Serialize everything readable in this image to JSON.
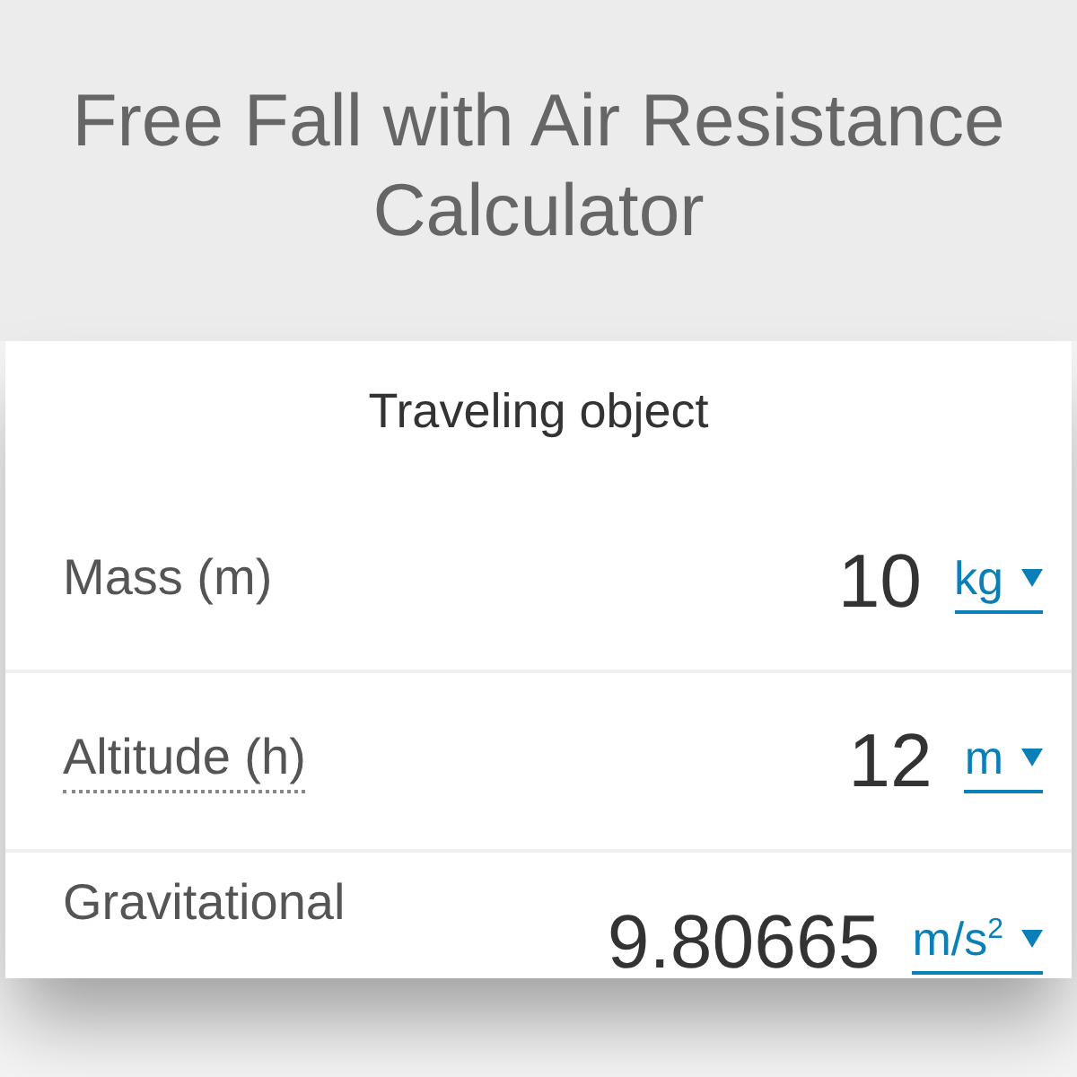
{
  "title": "Free Fall with Air Resistance Calculator",
  "section": {
    "title": "Traveling object"
  },
  "fields": [
    {
      "label": "Mass (m)",
      "has_tooltip": false,
      "value": "10",
      "unit": "kg"
    },
    {
      "label": "Altitude (h)",
      "has_tooltip": true,
      "value": "12",
      "unit": "m"
    },
    {
      "label": "Gravitational",
      "has_tooltip": false,
      "value": "9.80665",
      "unit": "m/s$^{2}$"
    }
  ]
}
